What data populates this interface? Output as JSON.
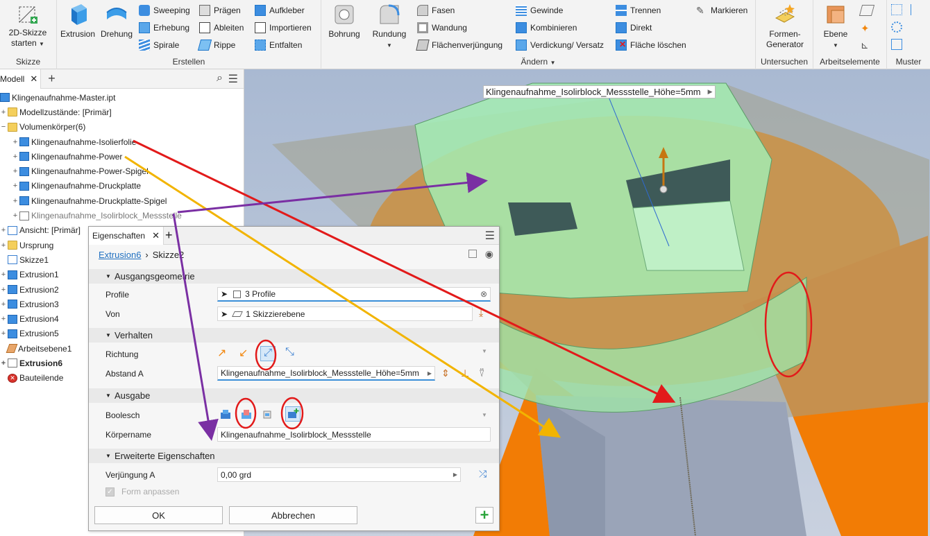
{
  "ribbon": {
    "skizze": {
      "start_label": "2D-Skizze starten",
      "group": "Skizze"
    },
    "erstellen": {
      "group": "Erstellen",
      "extrusion": "Extrusion",
      "drehung": "Drehung",
      "col1": [
        "Sweeping",
        "Erhebung",
        "Spirale"
      ],
      "col2": [
        "Prägen",
        "Ableiten",
        "Rippe"
      ],
      "col3": [
        "Aufkleber",
        "Importieren",
        "Entfalten"
      ]
    },
    "aendern": {
      "group": "Ändern",
      "bohrung": "Bohrung",
      "rundung": "Rundung",
      "col1": [
        "Fasen",
        "Wandung",
        "Flächenverjüngung"
      ],
      "col2": [
        "Gewinde",
        "Kombinieren",
        "Verdickung/ Versatz"
      ],
      "col3": [
        "Trennen",
        "Direkt",
        "Fläche löschen"
      ],
      "markieren": "Markieren"
    },
    "untersuchen": {
      "group": "Untersuchen",
      "formen": "Formen-Generator"
    },
    "arbeitselemente": {
      "group": "Arbeitselemente",
      "ebene": "Ebene"
    },
    "muster": {
      "group": "Muster"
    }
  },
  "browser": {
    "tab": "Modell",
    "items": [
      {
        "label": "Klingenaufnahme-Master.ipt",
        "icon": "part-icon"
      },
      {
        "label": "Modellzustände: [Primär]",
        "icon": "folder-icon"
      },
      {
        "label": "Volumenkörper(6)",
        "icon": "folder-icon"
      },
      {
        "label": "Klingenaufnahme-Isolierfolie",
        "icon": "solid-icon"
      },
      {
        "label": "Klingenaufnahme-Power",
        "icon": "solid-icon"
      },
      {
        "label": "Klingenaufnahme-Power-Spigel",
        "icon": "solid-icon"
      },
      {
        "label": "Klingenaufnahme-Druckplatte",
        "icon": "solid-icon"
      },
      {
        "label": "Klingenaufnahme-Druckplatte-Spigel",
        "icon": "solid-icon"
      },
      {
        "label": "Klingenaufnahme_Isolirblock_Messstelle",
        "icon": "ghost-solid-icon"
      },
      {
        "label": "Ansicht: [Primär]",
        "icon": "view-icon"
      },
      {
        "label": "Ursprung",
        "icon": "folder-icon"
      },
      {
        "label": "Skizze1",
        "icon": "sketch-icon"
      },
      {
        "label": "Extrusion1",
        "icon": "extrusion-icon"
      },
      {
        "label": "Extrusion2",
        "icon": "extrusion-icon"
      },
      {
        "label": "Extrusion3",
        "icon": "extrusion-icon"
      },
      {
        "label": "Extrusion4",
        "icon": "extrusion-icon"
      },
      {
        "label": "Extrusion5",
        "icon": "extrusion-icon"
      },
      {
        "label": "Arbeitsebene1",
        "icon": "workplane-icon"
      },
      {
        "label": "Extrusion6",
        "icon": "extrusion-icon"
      },
      {
        "label": "Bauteilende",
        "icon": "end-of-part-icon"
      }
    ]
  },
  "viewport": {
    "tooltip": "Klingenaufnahme_Isolirblock_Messstelle_Höhe=5mm"
  },
  "properties": {
    "tab": "Eigenschaften",
    "crumb_link": "Extrusion6",
    "crumb_current": "Skizze2",
    "sect_input": "Ausgangsgeometrie",
    "profile_label": "Profile",
    "profile_value": "3 Profile",
    "von_label": "Von",
    "von_value": "1 Skizzierebene",
    "sect_behavior": "Verhalten",
    "richtung_label": "Richtung",
    "abstand_label": "Abstand A",
    "abstand_value": "Klingenaufnahme_Isolirblock_Messstelle_Höhe=5mm",
    "sect_output": "Ausgabe",
    "boolesch_label": "Boolesch",
    "koerpername_label": "Körpername",
    "koerpername_value": "Klingenaufnahme_Isolirblock_Messstelle",
    "sect_advanced": "Erweiterte Eigenschaften",
    "verjuengung_label": "Verjüngung A",
    "verjuengung_value": "0,00 grd",
    "form_anpassen": "Form anpassen",
    "ok": "OK",
    "cancel": "Abbrechen"
  },
  "colors": {
    "annotation_red": "#e21a1a",
    "annotation_yellow": "#f2b400",
    "annotation_purple": "#7a2fa3",
    "orange_body": "#f2870e",
    "green_body": "#9fe4a8"
  }
}
